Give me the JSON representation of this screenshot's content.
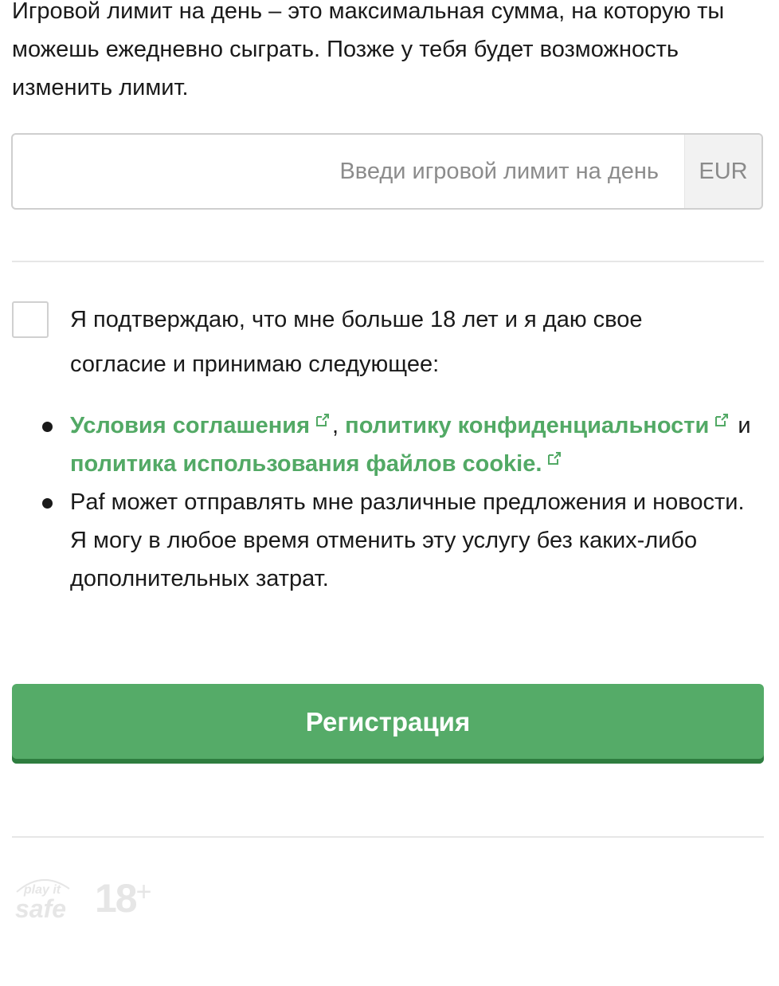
{
  "intro": {
    "text": "Игровой лимит на день – это максимальная сумма, на которую ты можешь ежедневно сыграть. Позже у тебя будет возможность изменить лимит."
  },
  "limit": {
    "value": "",
    "placeholder": "Введи игровой лимит на день",
    "currency": "EUR"
  },
  "consent": {
    "checked": false,
    "text": "Я подтверждаю, что мне больше 18 лет и я даю свое согласие и принимаю следующее:"
  },
  "bullets": {
    "terms_link": "Условия соглашения",
    "comma": ",",
    "privacy_link": "политику конфиденциальности",
    "and": "и",
    "cookie_link": "политика использования файлов cookie.",
    "marketing": "Paf может отправлять мне различные предложения и новости. Я могу в любое время отменить эту услугу без каких-либо дополнительных затрат."
  },
  "submit": {
    "label": "Регистрация"
  },
  "footer": {
    "playitsafe_top": "play it",
    "playitsafe_bottom": "safe",
    "age": "18",
    "age_plus": "+"
  },
  "colors": {
    "accent": "#52a965",
    "button": "#55ab68",
    "button_shadow": "#2e7d3f",
    "muted_logo": "#e6e6e6"
  },
  "icons": {
    "external_link": "external-link-icon"
  }
}
